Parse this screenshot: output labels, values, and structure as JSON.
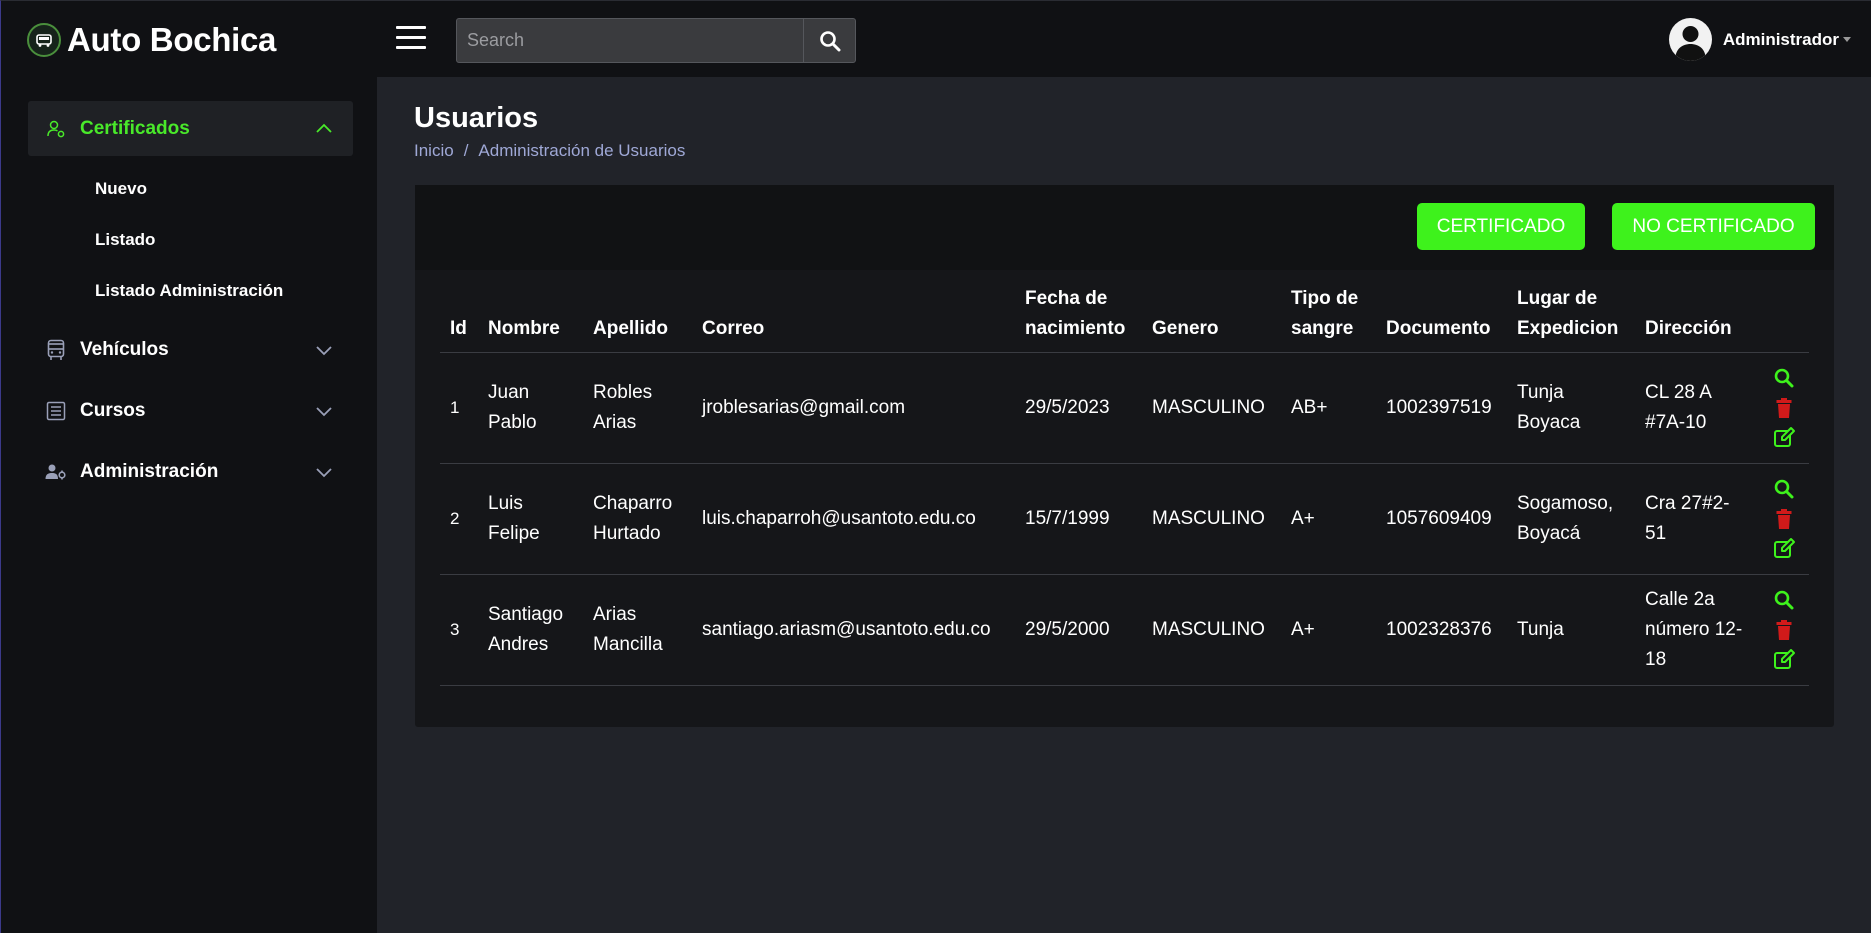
{
  "header": {
    "brand": "Auto Bochica",
    "search_placeholder": "Search",
    "user_name": "Administrador"
  },
  "sidebar": {
    "items": [
      {
        "label": "Certificados",
        "icon": "user-gear-icon",
        "expanded": true
      },
      {
        "label": "Vehículos",
        "icon": "bus-icon",
        "expanded": false
      },
      {
        "label": "Cursos",
        "icon": "list-icon",
        "expanded": false
      },
      {
        "label": "Administración",
        "icon": "users-gear-icon",
        "expanded": false
      }
    ],
    "subitems": [
      "Nuevo",
      "Listado",
      "Listado Administración"
    ]
  },
  "page": {
    "title": "Usuarios",
    "breadcrumb_home": "Inicio",
    "breadcrumb_separator": "/",
    "breadcrumb_current": "Administración de Usuarios"
  },
  "buttons": {
    "certified": "CERTIFICADO",
    "not_certified": "NO CERTIFICADO"
  },
  "table": {
    "headers": [
      "Id",
      "Nombre",
      "Apellido",
      "Correo",
      "Fecha de nacimiento",
      "Genero",
      "Tipo de sangre",
      "Documento",
      "Lugar de Expedicion",
      "Dirección"
    ],
    "rows": [
      {
        "id": "1",
        "nombre": "Juan Pablo",
        "apellido": "Robles Arias",
        "correo": "jroblesarias@gmail.com",
        "fecha": "29/5/2023",
        "genero": "MASCULINO",
        "sangre": "AB+",
        "documento": "1002397519",
        "lugar": "Tunja Boyaca",
        "direccion": "CL 28 A #7A-10"
      },
      {
        "id": "2",
        "nombre": "Luis Felipe",
        "apellido": "Chaparro Hurtado",
        "correo": "luis.chaparroh@usantoto.edu.co",
        "fecha": "15/7/1999",
        "genero": "MASCULINO",
        "sangre": "A+",
        "documento": "1057609409",
        "lugar": "Sogamoso, Boyacá",
        "direccion": "Cra 27#2-51"
      },
      {
        "id": "3",
        "nombre": "Santiago Andres",
        "apellido": "Arias Mancilla",
        "correo": "santiago.ariasm@usantoto.edu.co",
        "fecha": "29/5/2000",
        "genero": "MASCULINO",
        "sangre": "A+",
        "documento": "1002328376",
        "lugar": "Tunja",
        "direccion": "Calle 2a número 12-18"
      }
    ]
  },
  "colors": {
    "accent": "#3ef21c",
    "danger": "#d11a1a",
    "breadcrumb": "#9fa8d6"
  }
}
